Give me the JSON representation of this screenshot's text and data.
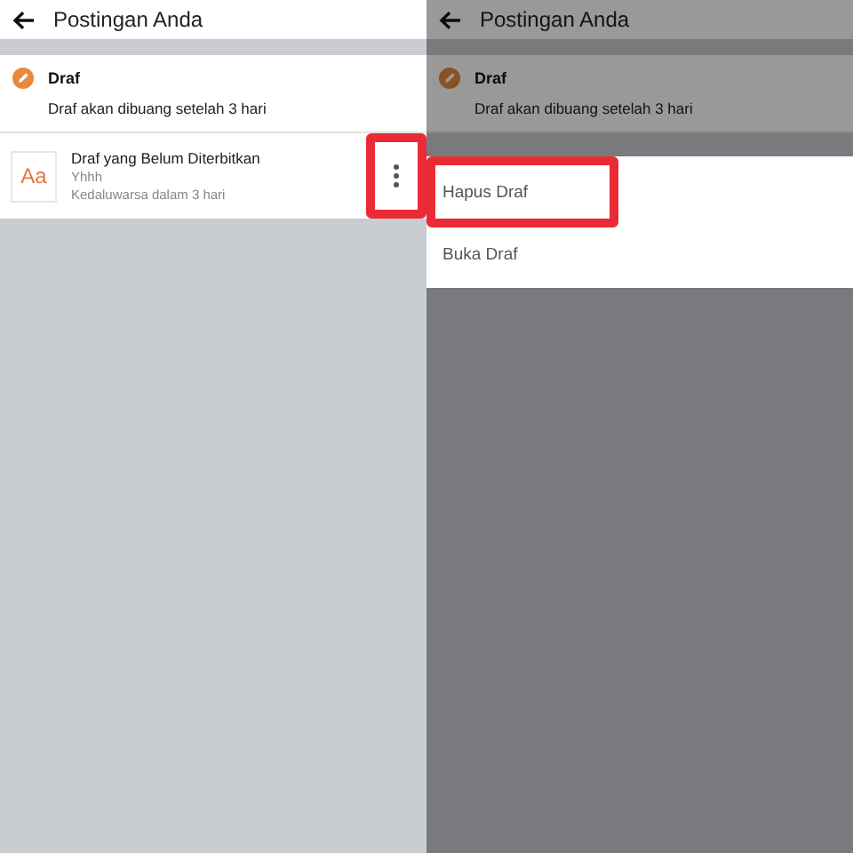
{
  "panels": [
    {
      "header": {
        "title": "Postingan Anda"
      },
      "section": {
        "title": "Draf",
        "subtitle": "Draf akan dibuang setelah 3 hari"
      },
      "dimmed": false,
      "draft": {
        "thumb": "Aa",
        "title": "Draf yang Belum Diterbitkan",
        "text": "Yhhh",
        "expiry": "Kedaluwarsa dalam 3 hari",
        "highlighted": true
      }
    },
    {
      "header": {
        "title": "Postingan Anda"
      },
      "section": {
        "title": "Draf",
        "subtitle": "Draf akan dibuang setelah 3 hari"
      },
      "dimmed": true,
      "menu": [
        {
          "label": "Hapus Draf",
          "highlighted": true
        },
        {
          "label": "Buka Draf",
          "highlighted": false
        }
      ]
    }
  ]
}
